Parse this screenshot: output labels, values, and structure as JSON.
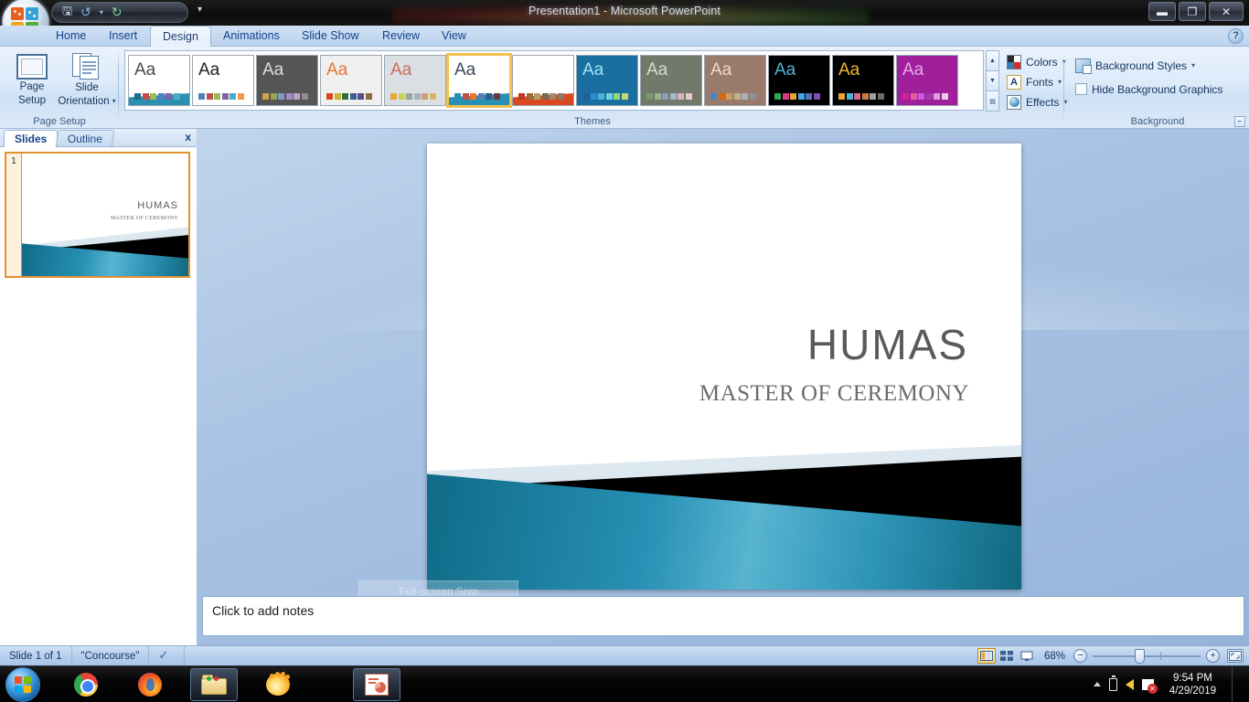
{
  "window": {
    "title": "Presentation1 - Microsoft PowerPoint",
    "minimize_label": "—",
    "restore_label": "❐",
    "close_label": "✕"
  },
  "quick_access": {
    "items": [
      {
        "name": "save-icon",
        "glyph": "💾"
      },
      {
        "name": "undo-icon",
        "glyph": "↺"
      },
      {
        "name": "undo-dropdown-icon",
        "glyph": "▾"
      },
      {
        "name": "redo-icon",
        "glyph": "↻"
      }
    ],
    "customize_label": "▾"
  },
  "office_button": {
    "label": "Office Button"
  },
  "help_button": {
    "label": "?"
  },
  "ribbon": {
    "tabs": [
      {
        "label": "Home",
        "active": false
      },
      {
        "label": "Insert",
        "active": false
      },
      {
        "label": "Design",
        "active": true
      },
      {
        "label": "Animations",
        "active": false
      },
      {
        "label": "Slide Show",
        "active": false
      },
      {
        "label": "Review",
        "active": false
      },
      {
        "label": "View",
        "active": false
      }
    ],
    "page_setup_group": {
      "label": "Page Setup",
      "page_setup_button": "Page\nSetup",
      "page_setup_line1": "Page",
      "page_setup_line2": "Setup",
      "slide_orientation_line1": "Slide",
      "slide_orientation_line2": "Orientation"
    },
    "themes_group": {
      "label": "Themes",
      "sample_text": "Aa",
      "thumbnails": [
        {
          "name": "theme-office",
          "bg": "#ffffff",
          "aa_color": "#4a4a4a",
          "selected": false,
          "swatches": [
            "#1f6f8b",
            "#c0504d",
            "#9bbb59",
            "#4f81bd",
            "#8064a2",
            "#4bacc6"
          ],
          "band": "#2a8fb0"
        },
        {
          "name": "theme-apex",
          "bg": "#ffffff",
          "aa_color": "#222222",
          "selected": false,
          "swatches": [
            "#4f81bd",
            "#c0504d",
            "#9bbb59",
            "#8064a2",
            "#4bacc6",
            "#f79646"
          ],
          "band": ""
        },
        {
          "name": "theme-aspect",
          "bg": "#555555",
          "aa_color": "#dcdcdc",
          "selected": false,
          "swatches": [
            "#d3a34a",
            "#9aa655",
            "#7b9ec7",
            "#a58bc0",
            "#c1a0cf",
            "#8f8f8f"
          ],
          "band": ""
        },
        {
          "name": "theme-civic",
          "bg": "#efefef",
          "aa_color": "#e8762d",
          "selected": false,
          "swatches": [
            "#d34817",
            "#c9b13b",
            "#2f6f3e",
            "#3d5f8a",
            "#5a4a8a",
            "#8a6f3a"
          ],
          "band": ""
        },
        {
          "name": "theme-concourse-alt",
          "bg": "#d9dfe2",
          "aa_color": "#d06a5a",
          "selected": false,
          "swatches": [
            "#e8a33d",
            "#c7d05a",
            "#9aa0a6",
            "#aab3bb",
            "#c9a07a",
            "#e0b36a"
          ],
          "band": ""
        },
        {
          "name": "theme-concourse",
          "bg": "#ffffff",
          "aa_color": "#3b4a57",
          "selected": true,
          "swatches": [
            "#2790b4",
            "#c0504d",
            "#e8762d",
            "#4f81bd",
            "#2f5f8a",
            "#6a3a3a"
          ],
          "band": "#2790b4"
        },
        {
          "name": "theme-equity",
          "bg": "#ffffff",
          "aa_color": "#ffffff",
          "selected": false,
          "swatches": [
            "#c0392b",
            "#9a6a3a",
            "#b5a06a",
            "#7a6a5a",
            "#a08a6a",
            "#8a7a6a"
          ],
          "band": "#d9481f"
        },
        {
          "name": "theme-flow",
          "bg": "#1a6fa0",
          "aa_color": "#9fe3f5",
          "selected": false,
          "swatches": [
            "#1f5f9c",
            "#2f8fc9",
            "#4fb3d9",
            "#6fcfe3",
            "#8fd96f",
            "#c9d96f"
          ],
          "band": ""
        },
        {
          "name": "theme-foundry",
          "bg": "#72786a",
          "aa_color": "#d7ddcf",
          "selected": false,
          "swatches": [
            "#7a9a6a",
            "#9ab38a",
            "#8aa0b5",
            "#a5b8c9",
            "#d9b5c0",
            "#e3c9d2"
          ],
          "band": ""
        },
        {
          "name": "theme-median",
          "bg": "#9a7a6a",
          "aa_color": "#f0d9c9",
          "selected": false,
          "swatches": [
            "#4f81bd",
            "#d9641e",
            "#c9a05a",
            "#bfae94",
            "#a8b2bb",
            "#8a9299"
          ],
          "band": ""
        },
        {
          "name": "theme-metro",
          "bg": "#000000",
          "aa_color": "#4fb3d9",
          "selected": false,
          "swatches": [
            "#2fa84f",
            "#d63b8a",
            "#e8a33d",
            "#3fa9d9",
            "#5f6fc0",
            "#7a4fb0"
          ],
          "band": ""
        },
        {
          "name": "theme-module",
          "bg": "#000000",
          "aa_color": "#f0b429",
          "selected": false,
          "swatches": [
            "#e8a33d",
            "#4fb3d9",
            "#d96a8a",
            "#c97a4a",
            "#a0a0a0",
            "#6a6a6a"
          ],
          "band": ""
        },
        {
          "name": "theme-opulent",
          "bg": "#a0209c",
          "aa_color": "#e9a8e6",
          "selected": false,
          "swatches": [
            "#d0219c",
            "#e85aa0",
            "#c95ad9",
            "#a03ab0",
            "#e0a0d9",
            "#f0c9e6"
          ],
          "band": ""
        }
      ],
      "scroll_up": "▲",
      "scroll_down": "▼",
      "more": "▤",
      "colors_label": "Colors",
      "fonts_label": "Fonts",
      "fonts_glyph": "A",
      "effects_label": "Effects",
      "dropdown_caret": "▾"
    },
    "background_group": {
      "label": "Background",
      "background_styles_label": "Background Styles",
      "hide_background_graphics_label": "Hide Background Graphics",
      "dropdown_caret": "▾",
      "dialog_launcher": "⌐"
    }
  },
  "left_pane": {
    "tabs": [
      {
        "label": "Slides",
        "active": true
      },
      {
        "label": "Outline",
        "active": false
      }
    ],
    "close_label": "x",
    "slides": [
      {
        "number": "1",
        "title": "HUMAS",
        "subtitle": "MASTER OF CEREMONY"
      }
    ]
  },
  "slide": {
    "title": "HUMAS",
    "subtitle": "MASTER OF CEREMONY",
    "colors": {
      "teal_band": "#2790b4",
      "black_band": "#000000",
      "light_wedge": "#d7e4ec"
    }
  },
  "ghost_tooltip": {
    "label": "Full-screen Snip"
  },
  "notes": {
    "placeholder": "Click to add notes"
  },
  "status_bar": {
    "slide_count_label": "Slide 1 of 1",
    "theme_label": "\"Concourse\"",
    "spellcheck_icon": "spellcheck-icon",
    "view_buttons": [
      {
        "name": "normal-view-button",
        "selected": true
      },
      {
        "name": "slide-sorter-view-button",
        "selected": false
      },
      {
        "name": "slide-show-view-button",
        "selected": false
      }
    ],
    "zoom_level": "68%",
    "zoom_out_label": "−",
    "zoom_in_label": "+",
    "fit_to_window_label": "fit-slide-to-window"
  },
  "taskbar": {
    "start_label": "Start",
    "items": [
      {
        "name": "taskbar-chrome",
        "label": "Google Chrome",
        "active": false
      },
      {
        "name": "taskbar-firefox",
        "label": "Mozilla Firefox",
        "active": false
      },
      {
        "name": "taskbar-explorer",
        "label": "Windows Explorer",
        "active": true
      },
      {
        "name": "taskbar-media-player",
        "label": "Media Player",
        "active": false
      },
      {
        "name": "taskbar-powerpoint",
        "label": "Microsoft PowerPoint",
        "active": true
      }
    ],
    "tray": {
      "show_hidden_label": "▲",
      "battery_label": "battery-icon",
      "volume_label": "volume-icon",
      "network_label": "network-error-icon"
    },
    "clock": {
      "time": "9:54 PM",
      "date": "4/29/2019"
    }
  }
}
